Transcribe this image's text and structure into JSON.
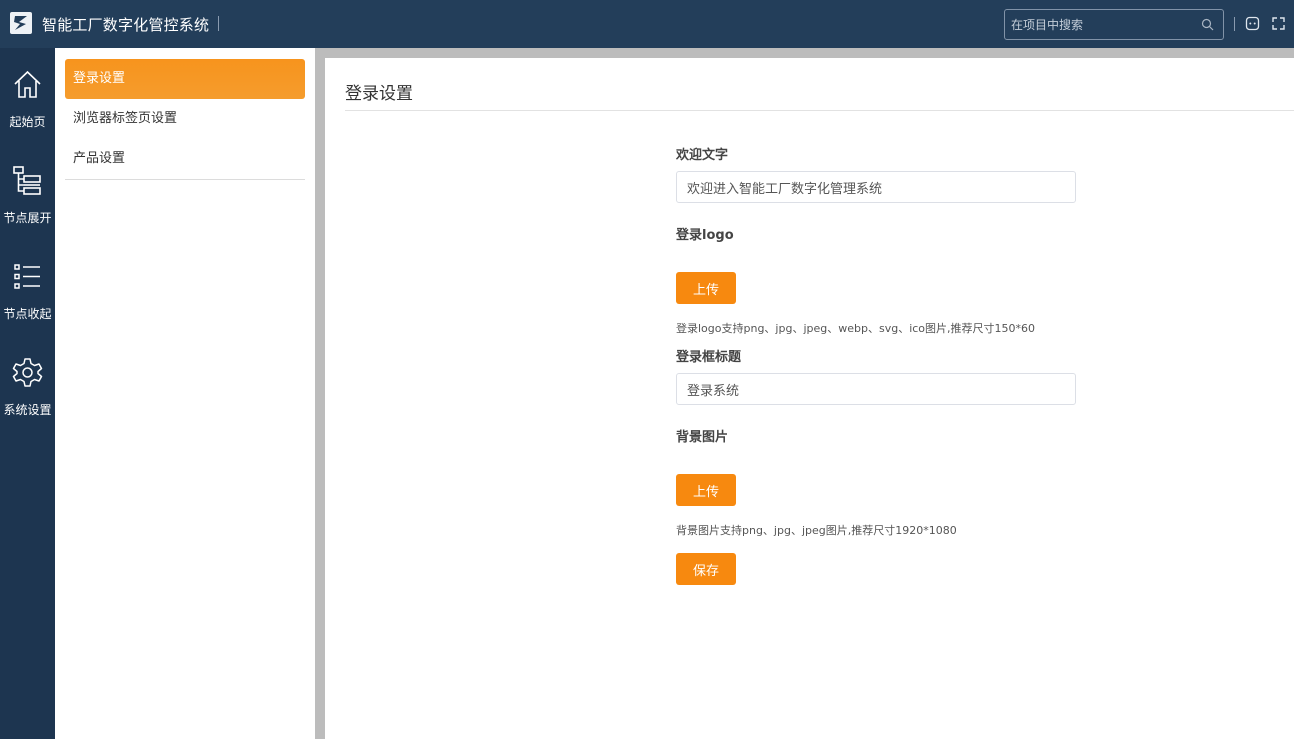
{
  "header": {
    "app_title": "智能工厂数字化管控系统",
    "search_placeholder": "在项目中搜索"
  },
  "rail": {
    "items": [
      {
        "label": "起始页",
        "icon": "home-icon"
      },
      {
        "label": "节点展开",
        "icon": "tree-expand-icon"
      },
      {
        "label": "节点收起",
        "icon": "list-collapse-icon"
      },
      {
        "label": "系统设置",
        "icon": "gear-icon"
      }
    ]
  },
  "submenu": {
    "items": [
      {
        "label": "登录设置",
        "active": true
      },
      {
        "label": "浏览器标签页设置",
        "active": false
      },
      {
        "label": "产品设置",
        "active": false
      }
    ]
  },
  "main": {
    "title": "登录设置",
    "welcome_label": "欢迎文字",
    "welcome_value": "欢迎进入智能工厂数字化管理系统",
    "logo_label": "登录logo",
    "upload_label": "上传",
    "logo_hint": "登录logo支持png、jpg、jpeg、webp、svg、ico图片,推荐尺寸150*60",
    "box_title_label": "登录框标题",
    "box_title_value": "登录系统",
    "bg_label": "背景图片",
    "bg_hint": "背景图片支持png、jpg、jpeg图片,推荐尺寸1920*1080",
    "save_label": "保存"
  },
  "colors": {
    "header_bg": "#233e5a",
    "rail_bg": "#1d3550",
    "accent": "#f7890f"
  }
}
